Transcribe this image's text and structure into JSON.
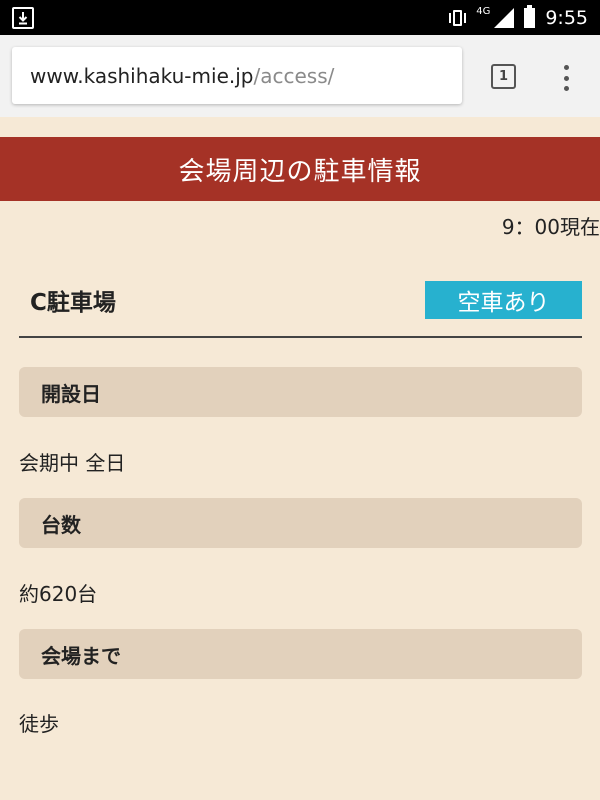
{
  "status_bar": {
    "network": "4G",
    "time": "9:55",
    "icons": [
      "download-icon",
      "vibrate-icon",
      "signal-icon",
      "battery-icon"
    ]
  },
  "browser": {
    "url_domain": "www.kashihaku-mie.jp",
    "url_path": "/access/",
    "tab_count": "1"
  },
  "page": {
    "header": "会場周辺の駐車情報",
    "timestamp": "9：00現在",
    "lot": {
      "name": "C駐車場",
      "status": "空車あり",
      "status_color": "#27b1cf"
    },
    "sections": [
      {
        "label": "開設日",
        "value": "会期中 全日"
      },
      {
        "label": "台数",
        "value": "約620台"
      },
      {
        "label": "会場まで",
        "value": "徒歩"
      }
    ]
  },
  "colors": {
    "banner": "#a53226",
    "background": "#f6e9d6",
    "section_header": "#e2d1bc"
  }
}
